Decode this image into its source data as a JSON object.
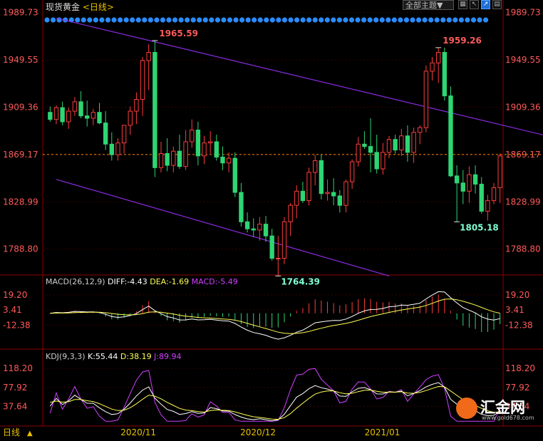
{
  "header": {
    "title": "现货黄金",
    "subtitle": "<日线>",
    "theme_button": "全部主题▼",
    "icons": [
      "grid-icon",
      "cursor-icon",
      "chart-mode-icon",
      "panel-icon"
    ]
  },
  "colors": {
    "up": "#ff3d3d",
    "down": "#2ed573",
    "price_label": "#ff5a5a",
    "grid": "#3a0000",
    "channel": "#8a2be2",
    "last_line": "#ff8c00",
    "diff": "#ffffff",
    "dea": "#ffff55",
    "macd": "#d040ff",
    "k": "#ffffff",
    "d": "#ffff55",
    "j": "#d040ff",
    "event_dot": "#2a8cff"
  },
  "chart_data": [
    {
      "type": "candlestick",
      "title": "现货黄金 <日线>",
      "price_axis_ticks": [
        "1989.73",
        "1949.55",
        "1909.36",
        "1869.17",
        "1828.99",
        "1788.80"
      ],
      "ylim": [
        1768,
        1992
      ],
      "x_labels": [
        "2020/11",
        "2020/12",
        "2021/01"
      ],
      "last_price_line": 1869.17,
      "annotations": {
        "high_1": "1965.59",
        "low_1": "1764.39",
        "high_2": "1959.26",
        "low_2": "1805.18"
      },
      "channel_lines": [
        {
          "from": [
            1,
            1985
          ],
          "to": [
            95,
            1867
          ]
        },
        {
          "from": [
            1,
            1848
          ],
          "to": [
            55,
            1766
          ]
        }
      ],
      "ohlc": [
        [
          1905,
          1910,
          1897,
          1899
        ],
        [
          1899,
          1911,
          1895,
          1909
        ],
        [
          1909,
          1914,
          1894,
          1897
        ],
        [
          1897,
          1909,
          1891,
          1906
        ],
        [
          1906,
          1918,
          1902,
          1914
        ],
        [
          1914,
          1923,
          1900,
          1902
        ],
        [
          1902,
          1915,
          1893,
          1900
        ],
        [
          1900,
          1908,
          1894,
          1905
        ],
        [
          1905,
          1913,
          1895,
          1896
        ],
        [
          1896,
          1906,
          1873,
          1878
        ],
        [
          1878,
          1888,
          1864,
          1869
        ],
        [
          1869,
          1883,
          1864,
          1879
        ],
        [
          1879,
          1892,
          1870,
          1894
        ],
        [
          1894,
          1910,
          1886,
          1906
        ],
        [
          1906,
          1922,
          1895,
          1916
        ],
        [
          1916,
          1952,
          1902,
          1949
        ],
        [
          1949,
          1963,
          1924,
          1956
        ],
        [
          1956,
          1966,
          1850,
          1858
        ],
        [
          1858,
          1880,
          1854,
          1870
        ],
        [
          1870,
          1883,
          1855,
          1860
        ],
        [
          1860,
          1876,
          1854,
          1872
        ],
        [
          1872,
          1886,
          1857,
          1859
        ],
        [
          1859,
          1890,
          1856,
          1880
        ],
        [
          1880,
          1899,
          1875,
          1890
        ],
        [
          1890,
          1897,
          1860,
          1868
        ],
        [
          1868,
          1885,
          1861,
          1879
        ],
        [
          1879,
          1889,
          1870,
          1880
        ],
        [
          1880,
          1886,
          1864,
          1867
        ],
        [
          1867,
          1876,
          1856,
          1862
        ],
        [
          1862,
          1871,
          1854,
          1866
        ],
        [
          1866,
          1871,
          1833,
          1837
        ],
        [
          1837,
          1845,
          1808,
          1812
        ],
        [
          1812,
          1820,
          1803,
          1806
        ],
        [
          1806,
          1815,
          1799,
          1805
        ],
        [
          1805,
          1816,
          1796,
          1810
        ],
        [
          1810,
          1817,
          1795,
          1800
        ],
        [
          1800,
          1806,
          1779,
          1781
        ],
        [
          1781,
          1800,
          1766,
          1781
        ],
        [
          1781,
          1816,
          1776,
          1812
        ],
        [
          1812,
          1828,
          1800,
          1826
        ],
        [
          1826,
          1843,
          1815,
          1838
        ],
        [
          1838,
          1846,
          1828,
          1830
        ],
        [
          1830,
          1858,
          1826,
          1854
        ],
        [
          1854,
          1869,
          1843,
          1864
        ],
        [
          1864,
          1869,
          1831,
          1836
        ],
        [
          1836,
          1848,
          1830,
          1837
        ],
        [
          1837,
          1849,
          1826,
          1834
        ],
        [
          1834,
          1839,
          1820,
          1826
        ],
        [
          1826,
          1848,
          1820,
          1846
        ],
        [
          1846,
          1865,
          1840,
          1863
        ],
        [
          1863,
          1884,
          1859,
          1878
        ],
        [
          1878,
          1889,
          1874,
          1876
        ],
        [
          1876,
          1900,
          1854,
          1871
        ],
        [
          1871,
          1886,
          1853,
          1857
        ],
        [
          1857,
          1879,
          1852,
          1871
        ],
        [
          1871,
          1885,
          1866,
          1882
        ],
        [
          1882,
          1886,
          1870,
          1873
        ],
        [
          1873,
          1891,
          1868,
          1885
        ],
        [
          1885,
          1894,
          1863,
          1871
        ],
        [
          1871,
          1892,
          1862,
          1888
        ],
        [
          1888,
          1894,
          1878,
          1892
        ],
        [
          1892,
          1945,
          1888,
          1940
        ],
        [
          1940,
          1952,
          1932,
          1947
        ],
        [
          1947,
          1960,
          1930,
          1956
        ],
        [
          1956,
          1960,
          1915,
          1919
        ],
        [
          1919,
          1927,
          1850,
          1851
        ],
        [
          1851,
          1860,
          1812,
          1845
        ],
        [
          1845,
          1856,
          1827,
          1838
        ],
        [
          1838,
          1859,
          1828,
          1852
        ],
        [
          1852,
          1860,
          1836,
          1844
        ],
        [
          1844,
          1850,
          1819,
          1821
        ],
        [
          1821,
          1835,
          1813,
          1830
        ],
        [
          1830,
          1845,
          1827,
          1841
        ],
        [
          1841,
          1870,
          1828,
          1868
        ]
      ]
    },
    {
      "type": "macd",
      "params": "MACD(26,12,9)",
      "diff": "DIFF:-4.43",
      "dea": "DEA:-1.69",
      "macd": "MACD:-5.49",
      "axis_ticks": [
        "19.20",
        "3.41",
        "-12.38"
      ],
      "ylim": [
        -30,
        28
      ]
    },
    {
      "type": "kdj",
      "params": "KDJ(9,3,3)",
      "k": "K:55.44",
      "d": "D:38.19",
      "j": "J:89.94",
      "axis_ticks": [
        "118.20",
        "77.92",
        "37.64"
      ],
      "ylim": [
        5,
        135
      ]
    }
  ],
  "footer": {
    "tab_label": "日线",
    "watermark_name": "汇金网",
    "watermark_url": "www.gold678.com"
  }
}
